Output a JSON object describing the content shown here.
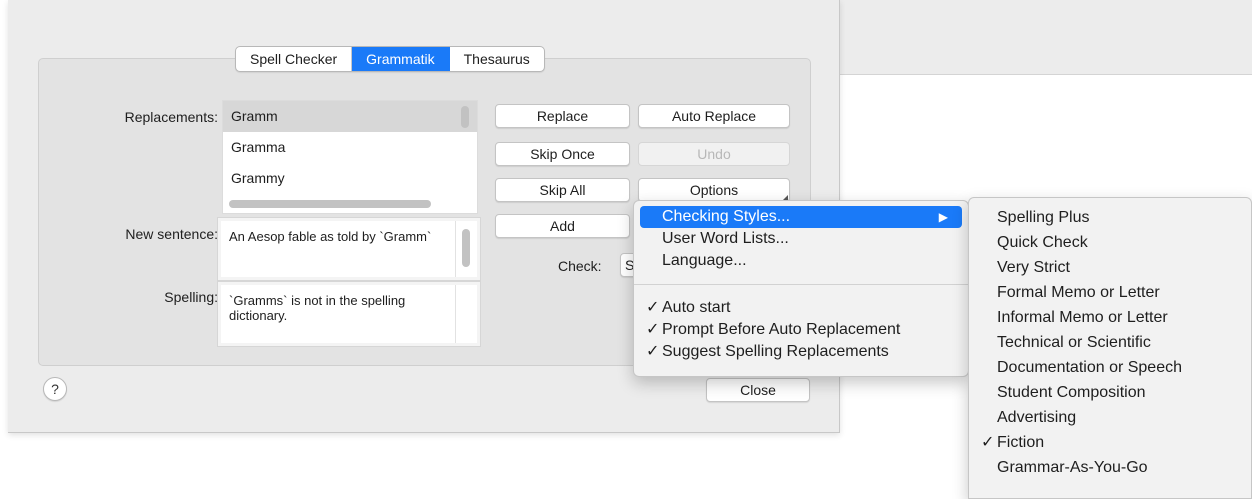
{
  "tabs": [
    "Spell Checker",
    "Grammatik",
    "Thesaurus"
  ],
  "active_tab": "Grammatik",
  "labels": {
    "replacements": "Replacements:",
    "new_sentence": "New sentence:",
    "spelling": "Spelling:",
    "check": "Check:"
  },
  "replacements": [
    "Gramm",
    "Gramma",
    "Grammy"
  ],
  "selected_replacement": "Gramm",
  "new_sentence_text": "An Aesop fable as told by `Gramm`",
  "spelling_text": "`Gramms` is not in the spelling dictionary.",
  "check_select_partial": "S",
  "buttons": {
    "replace": "Replace",
    "auto_replace": "Auto Replace",
    "skip_once": "Skip Once",
    "undo": "Undo",
    "skip_all": "Skip All",
    "options": "Options",
    "add": "Add",
    "close": "Close",
    "help": "?"
  },
  "options_menu": {
    "items": [
      "Checking Styles...",
      "User Word Lists...",
      "Language..."
    ],
    "toggles": [
      "Auto start",
      "Prompt Before Auto Replacement",
      "Suggest Spelling Replacements"
    ]
  },
  "styles_menu": {
    "items": [
      "Spelling Plus",
      "Quick Check",
      "Very Strict",
      "Formal Memo or Letter",
      "Informal Memo or Letter",
      "Technical or Scientific",
      "Documentation or Speech",
      "Student Composition",
      "Advertising",
      "Fiction",
      "Grammar-As-You-Go"
    ],
    "checked": "Fiction"
  },
  "check_glyph": "✓",
  "arrow_glyph": "▶",
  "colors": {
    "accent": "#1a7af8"
  }
}
